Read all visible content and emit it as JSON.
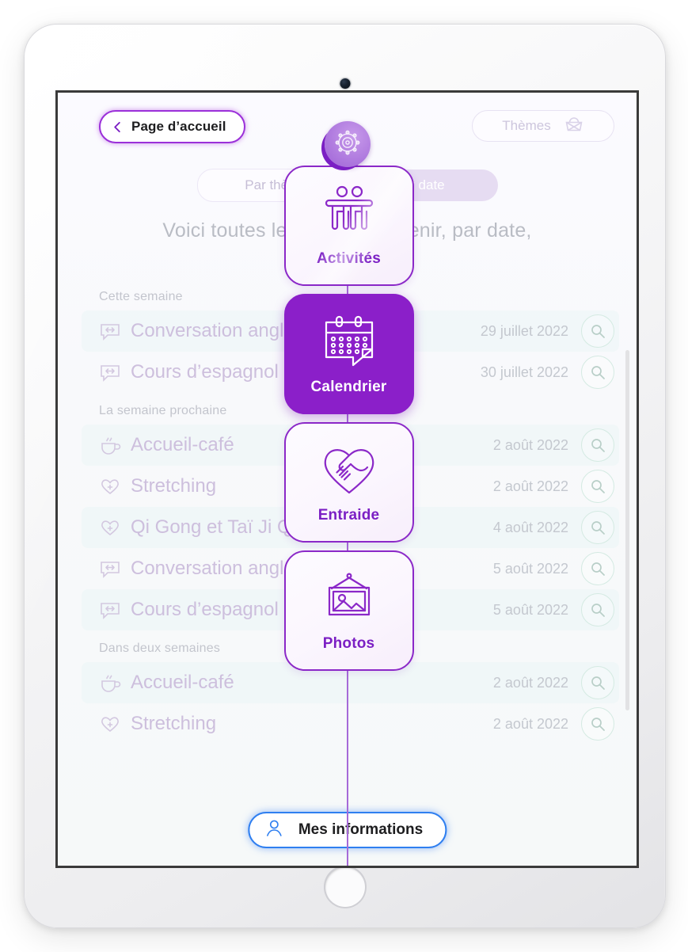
{
  "header": {
    "back_label": "Page d’accueil",
    "back_icon": "chevron-left-icon",
    "themes_label": "Thèmes",
    "themes_icon": "basket-icon",
    "wheel_icon": "ship-wheel-icon"
  },
  "tabs": [
    {
      "label": "Par thème",
      "active": false
    },
    {
      "label": "Par date",
      "active": true
    }
  ],
  "intro": "Voici toutes les activités à venir, par date,",
  "groups": [
    {
      "title": "Cette semaine",
      "rows": [
        {
          "icon": "speech-bubble-icon",
          "name": "Conversation anglaise",
          "date": "29 juillet 2022",
          "action_icon": "magnifier-icon"
        },
        {
          "icon": "speech-bubble-icon",
          "name": "Cours d’espagnol",
          "date": "30 juillet 2022",
          "action_icon": "magnifier-icon"
        }
      ]
    },
    {
      "title": "La semaine prochaine",
      "rows": [
        {
          "icon": "coffee-cup-icon",
          "name": "Accueil-café",
          "date": "2 août 2022",
          "action_icon": "magnifier-icon"
        },
        {
          "icon": "heart-plus-icon",
          "name": "Stretching",
          "date": "2 août 2022",
          "action_icon": "magnifier-icon"
        },
        {
          "icon": "heart-plus-icon",
          "name": "Qi Gong et Taï Ji Quan",
          "date": "4 août 2022",
          "action_icon": "magnifier-icon"
        },
        {
          "icon": "speech-bubble-icon",
          "name": "Conversation anglaise",
          "date": "5 août 2022",
          "action_icon": "magnifier-icon"
        },
        {
          "icon": "speech-bubble-icon",
          "name": "Cours d’espagnol",
          "date": "5 août 2022",
          "action_icon": "magnifier-icon"
        }
      ]
    },
    {
      "title": "Dans deux semaines",
      "rows": [
        {
          "icon": "coffee-cup-icon",
          "name": "Accueil-café",
          "date": "2 août 2022",
          "action_icon": "magnifier-icon"
        },
        {
          "icon": "heart-plus-icon",
          "name": "Stretching",
          "date": "2 août 2022",
          "action_icon": "magnifier-icon"
        }
      ]
    }
  ],
  "menu": [
    {
      "label": "Activités",
      "icon": "two-people-icon",
      "active": false
    },
    {
      "label": "Calendrier",
      "icon": "calendar-icon",
      "active": true
    },
    {
      "label": "Entraide",
      "icon": "heart-handshake-icon",
      "active": false
    },
    {
      "label": "Photos",
      "icon": "framed-picture-icon",
      "active": false
    }
  ],
  "footer": {
    "info_label": "Mes informations",
    "info_icon": "person-icon"
  },
  "colors": {
    "accent_purple": "#8b1fc9",
    "accent_purple_light": "#a66ad8",
    "screen_bg": "#fbfaff",
    "blue_accent": "#2f7ff0",
    "teal_outline": "#d4eae2"
  }
}
